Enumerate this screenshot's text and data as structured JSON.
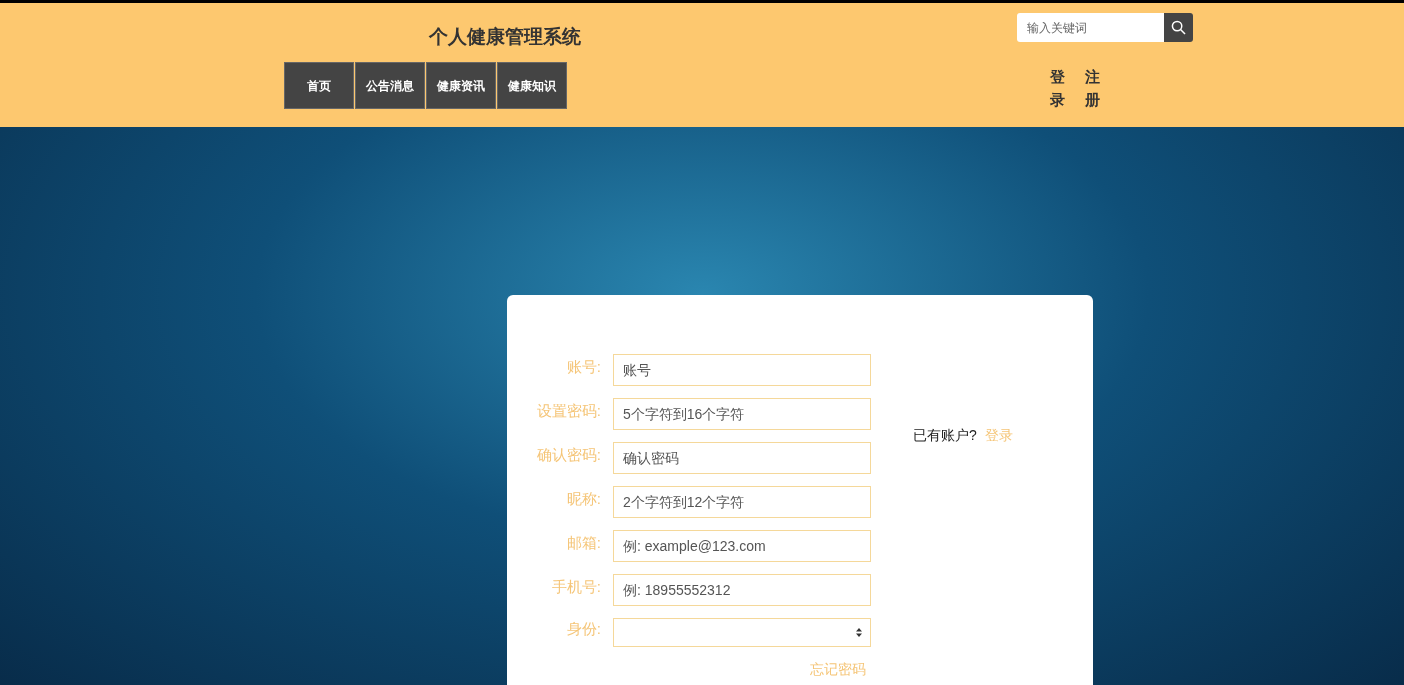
{
  "header": {
    "title": "个人健康管理系统",
    "nav": [
      {
        "label": "首页"
      },
      {
        "label": "公告消息"
      },
      {
        "label": "健康资讯"
      },
      {
        "label": "健康知识"
      }
    ],
    "search": {
      "placeholder": "输入关键词"
    },
    "auth_links": [
      {
        "label": "登录"
      },
      {
        "label": "注册"
      }
    ]
  },
  "form": {
    "fields": [
      {
        "kind": "input",
        "label": "账号:",
        "placeholder": "账号"
      },
      {
        "kind": "input",
        "label": "设置密码:",
        "placeholder": "5个字符到16个字符"
      },
      {
        "kind": "input",
        "label": "确认密码:",
        "placeholder": "确认密码"
      },
      {
        "kind": "input",
        "label": "昵称:",
        "placeholder": "2个字符到12个字符"
      },
      {
        "kind": "input",
        "label": "邮箱:",
        "placeholder": "例: example@123.com"
      },
      {
        "kind": "input",
        "label": "手机号:",
        "placeholder": "例: 18955552312"
      },
      {
        "kind": "select",
        "label": "身份:"
      }
    ],
    "have_account": "已有账户?",
    "login_link": "登录",
    "forgot_password": "忘记密码"
  }
}
